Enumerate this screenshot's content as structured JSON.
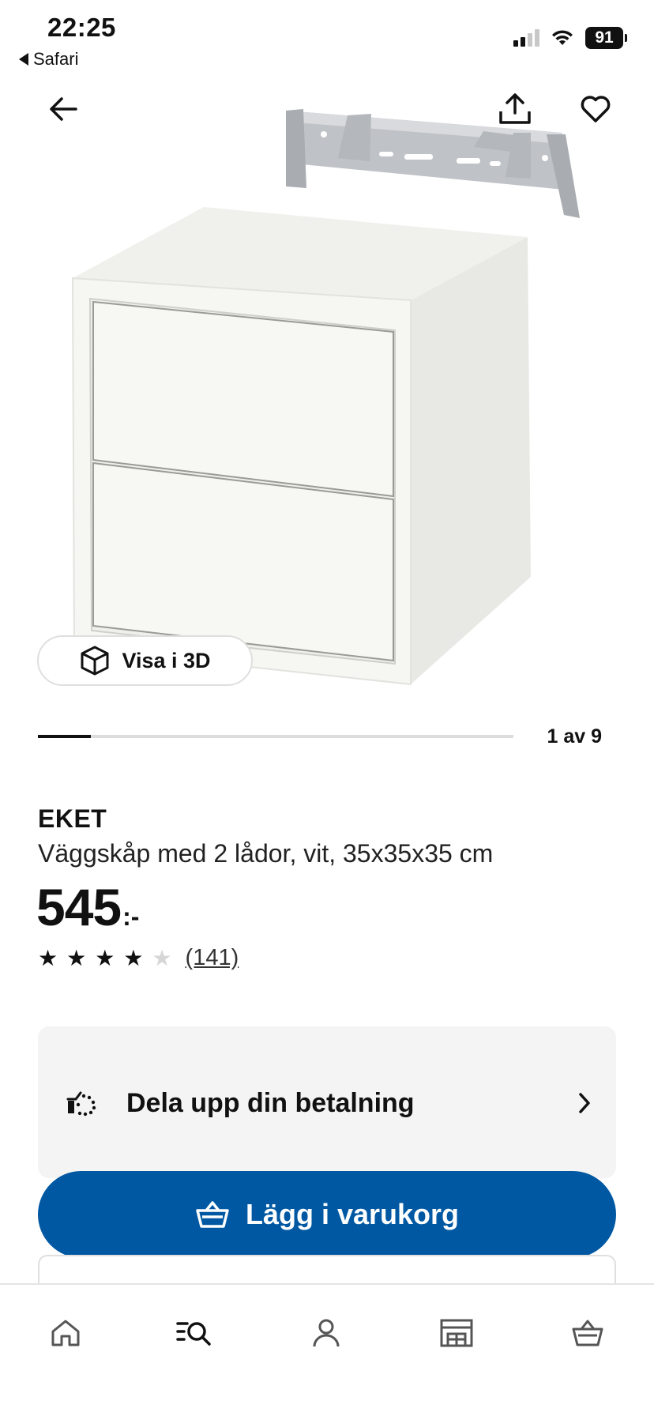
{
  "status_bar": {
    "time": "22:25",
    "back_app": "Safari",
    "battery": "91"
  },
  "icons": {
    "back": "arrow-left-icon",
    "share": "share-icon",
    "favourite": "heart-icon",
    "view3d": "cube-icon",
    "installment": "payment-split-icon",
    "chevron": "chevron-right-icon",
    "cart": "basket-icon"
  },
  "gallery": {
    "view3d_label": "Visa i 3D",
    "counter": "1 av 9",
    "current": 1,
    "total": 9
  },
  "product": {
    "name": "EKET",
    "description": "Väggskåp med 2 lådor, vit, 35x35x35 cm",
    "price": "545",
    "price_suffix": ":-",
    "rating": 4,
    "rating_max": 5,
    "review_count": "(141)"
  },
  "installment": {
    "label": "Dela upp din betalning"
  },
  "cart_button": {
    "label": "Lägg i varukorg",
    "color": "#0058a3"
  },
  "bottom_nav": {
    "items": [
      "home-icon",
      "search-list-icon",
      "profile-icon",
      "store-icon",
      "basket-icon"
    ],
    "active": "search-list-icon"
  }
}
